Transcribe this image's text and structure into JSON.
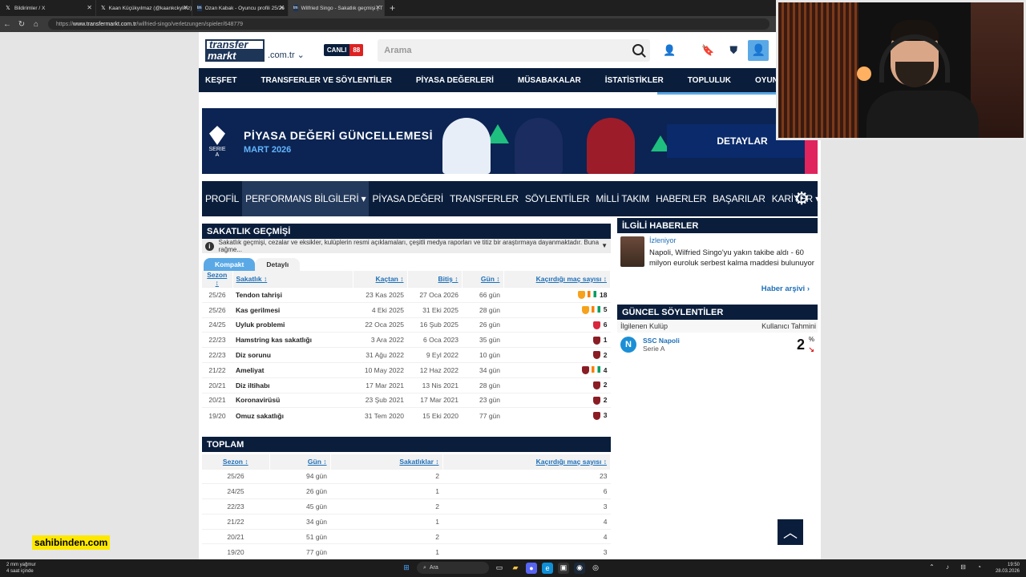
{
  "browser": {
    "tabs": [
      {
        "title": "Bildirimler / X",
        "icon": "x-icon"
      },
      {
        "title": "Kaan Küçükyılmaz (@kaankckylmz)",
        "icon": "x-icon"
      },
      {
        "title": "Ozan Kabak - Oyuncu profili 25/26",
        "icon": "transfermarkt-icon"
      },
      {
        "title": "Wilfried Singo - Sakatlık geçmişi | T",
        "icon": "transfermarkt-icon"
      }
    ],
    "url_prefix": "https://",
    "url_host": "www.transfermarkt.com.tr",
    "url_path": "/wilfried-singo/verletzungen/spieler/648779"
  },
  "header": {
    "logo_top": "transfer",
    "logo_bottom": "markt",
    "tld": ".com.tr ⌄",
    "live_label": "CANLI",
    "live_count": "88",
    "search_placeholder": "Arama"
  },
  "main_nav": [
    "KEŞFET",
    "TRANSFERLER VE SÖYLENTİLER",
    "PİYASA DEĞERLERİ",
    "MÜSABAKALAR",
    "İSTATİSTİKLER",
    "TOPLULUK",
    "OYUNLAR"
  ],
  "banner": {
    "league": "SERIE A",
    "title": "PİYASA DEĞERİ GÜNCELLEMESİ",
    "subtitle": "MART 2026",
    "cta": "DETAYLAR"
  },
  "sub_nav": [
    "PROFİL",
    "PERFORMANS BİLGİLERİ ▾",
    "PİYASA DEĞERİ",
    "TRANSFERLER",
    "SÖYLENTİLER",
    "MİLLİ TAKIM",
    "HABERLER",
    "BAŞARILAR",
    "KARİYER ▾"
  ],
  "injury": {
    "title": "SAKATLIK GEÇMİŞİ",
    "info": "Sakatlık geçmişi, cezalar ve eksikler, kulüplerin resmi açıklamaları, çeşitli medya raporları ve titiz bir araştırmaya dayanmaktadır. Buna rağme...",
    "tabs": [
      "Kompakt",
      "Detaylı"
    ],
    "columns": [
      "Sezon ↕",
      "Sakatlık ↕",
      "Kaçtan ↕",
      "Bitiş ↕",
      "Gün ↕",
      "Kaçırdığı maç sayısı ↕"
    ],
    "rows": [
      {
        "season": "25/26",
        "injury": "Tendon tahrişi",
        "from": "23 Kas 2025",
        "until": "27 Oca 2026",
        "days": "66 gün",
        "games": "18",
        "clubs": [
          "galatasaray",
          "ivory-coast"
        ]
      },
      {
        "season": "25/26",
        "injury": "Kas gerilmesi",
        "from": "4 Eki 2025",
        "until": "31 Eki 2025",
        "days": "28 gün",
        "games": "5",
        "clubs": [
          "galatasaray",
          "ivory-coast"
        ]
      },
      {
        "season": "24/25",
        "injury": "Uyluk problemi",
        "from": "22 Oca 2025",
        "until": "16 Şub 2025",
        "days": "26 gün",
        "games": "6",
        "clubs": [
          "monaco"
        ]
      },
      {
        "season": "22/23",
        "injury": "Hamstring kas sakatlığı",
        "from": "3 Ara 2022",
        "until": "6 Oca 2023",
        "days": "35 gün",
        "games": "1",
        "clubs": [
          "torino"
        ]
      },
      {
        "season": "22/23",
        "injury": "Diz sorunu",
        "from": "31 Ağu 2022",
        "until": "9 Eyl 2022",
        "days": "10 gün",
        "games": "2",
        "clubs": [
          "torino"
        ]
      },
      {
        "season": "21/22",
        "injury": "Ameliyat",
        "from": "10 May 2022",
        "until": "12 Haz 2022",
        "days": "34 gün",
        "games": "4",
        "clubs": [
          "torino",
          "ivory-coast"
        ]
      },
      {
        "season": "20/21",
        "injury": "Diz iltihabı",
        "from": "17 Mar 2021",
        "until": "13 Nis 2021",
        "days": "28 gün",
        "games": "2",
        "clubs": [
          "torino"
        ]
      },
      {
        "season": "20/21",
        "injury": "Koronavirüsü",
        "from": "23 Şub 2021",
        "until": "17 Mar 2021",
        "days": "23 gün",
        "games": "2",
        "clubs": [
          "torino"
        ]
      },
      {
        "season": "19/20",
        "injury": "Omuz sakatlığı",
        "from": "31 Tem 2020",
        "until": "15 Eki 2020",
        "days": "77 gün",
        "games": "3",
        "clubs": [
          "torino"
        ]
      }
    ]
  },
  "total": {
    "title": "TOPLAM",
    "columns": [
      "Sezon ↕",
      "Gün ↕",
      "Sakatlıklar ↕",
      "Kaçırdığı maç sayısı ↕"
    ],
    "rows": [
      {
        "season": "25/26",
        "days": "94 gün",
        "injuries": "2",
        "games": "23"
      },
      {
        "season": "24/25",
        "days": "26 gün",
        "injuries": "1",
        "games": "6"
      },
      {
        "season": "22/23",
        "days": "45 gün",
        "injuries": "2",
        "games": "3"
      },
      {
        "season": "21/22",
        "days": "34 gün",
        "injuries": "1",
        "games": "4"
      },
      {
        "season": "20/21",
        "days": "51 gün",
        "injuries": "2",
        "games": "4"
      },
      {
        "season": "19/20",
        "days": "77 gün",
        "injuries": "1",
        "games": "3"
      }
    ]
  },
  "news": {
    "title": "İLGİLİ HABERLER",
    "tag": "İzleniyor",
    "headline": "Napoli, Wilfried Singo'yu yakın takibe aldı - 60 milyon euroluk serbest kalma maddesi bulunuyor",
    "archive": "Haber arşivi ›"
  },
  "rumours": {
    "title": "GÜNCEL SÖYLENTİLER",
    "col_club": "İlgilenen Kulüp",
    "col_estimate": "Kullanıcı Tahmini",
    "club": "SSC Napoli",
    "league": "Serie A",
    "percent": "2",
    "percent_sign": "%"
  },
  "overlay": {
    "sahibinden": "sahibinden.com"
  },
  "taskbar": {
    "weather_line1": "2 mm yağmur",
    "weather_line2": "4 saat içinde",
    "search": "Ara",
    "time": "19:50",
    "date": "28.03.2026"
  },
  "colors": {
    "navy": "#0a1e3c",
    "accent_blue": "#5aa9e6",
    "link": "#1d6fb8"
  }
}
